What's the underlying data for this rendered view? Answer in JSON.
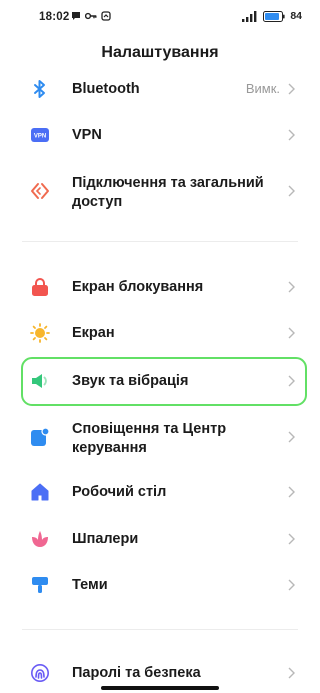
{
  "status_bar": {
    "time": "18:02",
    "battery_percent": "84"
  },
  "page": {
    "title": "Налаштування"
  },
  "items": [
    {
      "label": "Bluetooth",
      "value": "Вимк."
    },
    {
      "label": "VPN"
    },
    {
      "label_line1": "Підключення та загальний",
      "label_line2": "доступ"
    },
    {
      "label": "Екран блокування"
    },
    {
      "label": "Екран"
    },
    {
      "label": "Звук та вібрація"
    },
    {
      "label_line1": "Сповіщення та Центр",
      "label_line2": "керування"
    },
    {
      "label": "Робочий стіл"
    },
    {
      "label": "Шпалери"
    },
    {
      "label": "Теми"
    },
    {
      "label": "Паролі та безпека"
    }
  ],
  "icons": {
    "bluetooth": "bluetooth-icon",
    "vpn": "vpn-icon",
    "connection_sharing": "connection-sharing-icon",
    "lock_screen": "lock-icon",
    "display": "sun-icon",
    "sound": "speaker-icon",
    "notifications": "notification-icon",
    "home_screen": "home-icon",
    "wallpaper": "flower-icon",
    "themes": "paint-brush-icon",
    "passwords": "fingerprint-icon"
  },
  "colors": {
    "highlight": "#62e065",
    "bluetooth": "#2f8cf0",
    "vpn": "#4b6ef5",
    "connection": "#f06a4f",
    "lock": "#f2554f",
    "display": "#f7b52b",
    "sound": "#34c77b",
    "notifications": "#2f8cf0",
    "home": "#4b6ef5",
    "wallpaper": "#f06792",
    "themes": "#2f8cf0",
    "passwords": "#6a5cf5"
  }
}
